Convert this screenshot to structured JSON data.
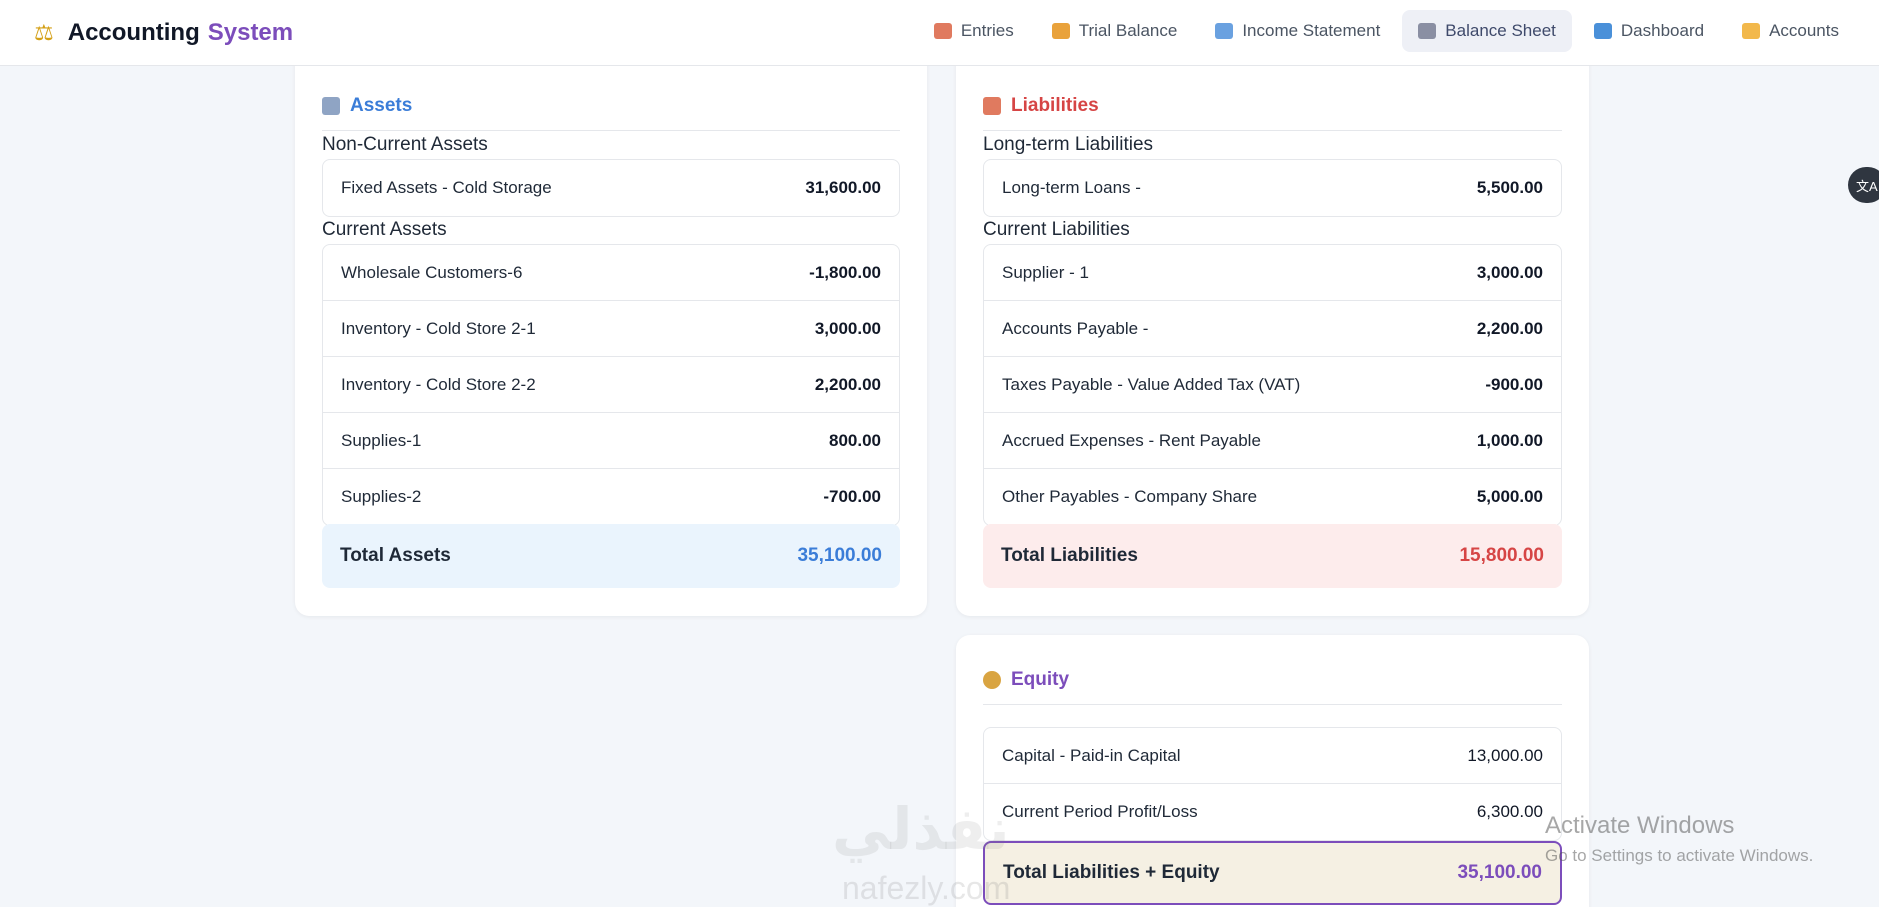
{
  "app": {
    "icon": "scales-icon",
    "title": "Accounting",
    "title_accent": "System"
  },
  "nav": [
    {
      "label": "Entries",
      "icon": "memo-icon",
      "color": "#e07a5f",
      "active": false
    },
    {
      "label": "Trial Balance",
      "icon": "bar-chart-icon",
      "color": "#e9a23b",
      "active": false
    },
    {
      "label": "Income Statement",
      "icon": "line-chart-icon",
      "color": "#6aa1e0",
      "active": false
    },
    {
      "label": "Balance Sheet",
      "icon": "bank-icon",
      "color": "#8a8fa3",
      "active": true
    },
    {
      "label": "Dashboard",
      "icon": "monitor-icon",
      "color": "#4a90d9",
      "active": false
    },
    {
      "label": "Accounts",
      "icon": "folder-icon",
      "color": "#f2b84b",
      "active": false
    }
  ],
  "assets": {
    "title": "Assets",
    "non_current_label": "Non-Current Assets",
    "non_current": [
      {
        "name": "Fixed Assets - Cold Storage",
        "amount": "31,600.00"
      }
    ],
    "current_label": "Current Assets",
    "current": [
      {
        "name": "Wholesale Customers-6",
        "amount": "-1,800.00"
      },
      {
        "name": "Inventory - Cold Store 2-1",
        "amount": "3,000.00"
      },
      {
        "name": "Inventory - Cold Store 2-2",
        "amount": "2,200.00"
      },
      {
        "name": "Supplies-1",
        "amount": "800.00"
      },
      {
        "name": "Supplies-2",
        "amount": "-700.00"
      }
    ],
    "total_label": "Total Assets",
    "total_value": "35,100.00"
  },
  "liabilities": {
    "title": "Liabilities",
    "long_term_label": "Long-term Liabilities",
    "long_term": [
      {
        "name": "Long-term Loans -",
        "amount": "5,500.00"
      }
    ],
    "current_label": "Current Liabilities",
    "current": [
      {
        "name": "Supplier - 1",
        "amount": "3,000.00"
      },
      {
        "name": "Accounts Payable -",
        "amount": "2,200.00"
      },
      {
        "name": "Taxes Payable - Value Added Tax (VAT)",
        "amount": "-900.00"
      },
      {
        "name": "Accrued Expenses - Rent Payable",
        "amount": "1,000.00"
      },
      {
        "name": "Other Payables - Company Share",
        "amount": "5,000.00"
      }
    ],
    "total_label": "Total Liabilities",
    "total_value": "15,800.00"
  },
  "equity": {
    "title": "Equity",
    "items": [
      {
        "name": "Capital - Paid-in Capital",
        "amount": "13,000.00"
      },
      {
        "name": "Current Period Profit/Loss",
        "amount": "6,300.00"
      }
    ],
    "total_label": "Total Liabilities + Equity",
    "total_value": "35,100.00"
  },
  "translate_button_label": "文A",
  "watermark": {
    "logo_text": "نفذلي",
    "url_text": "nafezly.com"
  },
  "activation": {
    "line1": "Activate Windows",
    "line2": "Go to Settings to activate Windows."
  }
}
